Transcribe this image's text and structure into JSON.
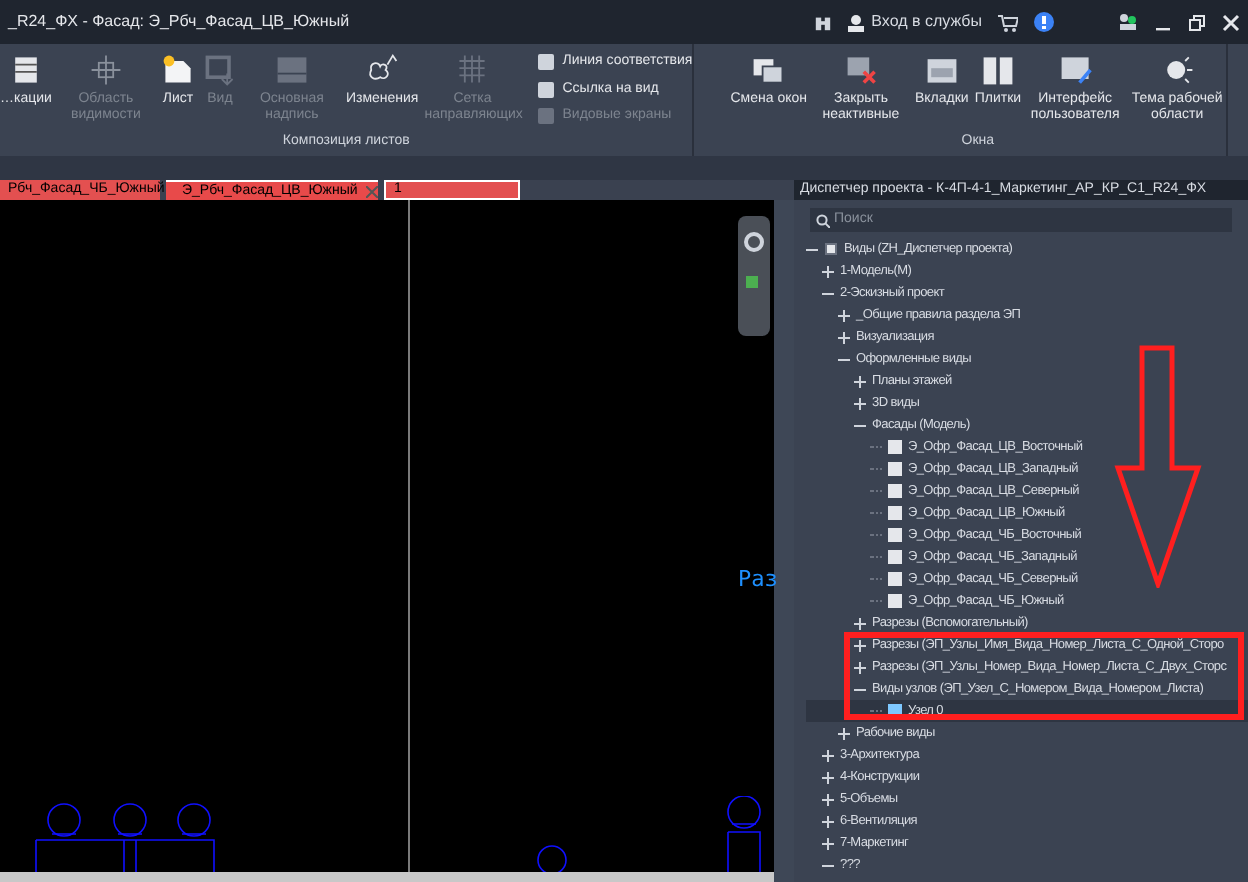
{
  "window": {
    "title": "_R24_ФХ - Фасад: Э_Рбч_Фасад_ЦВ_Южный",
    "sign_in": "Вход в службы"
  },
  "ribbon": {
    "panels": [
      {
        "label": "Композиция листов",
        "buttons": [
          {
            "label": "…кации",
            "disabled": false
          },
          {
            "label": "Область видимости",
            "disabled": true
          },
          {
            "label": "Лист",
            "disabled": false
          },
          {
            "label": "Вид",
            "disabled": true
          },
          {
            "label": "Основная надпись",
            "disabled": true
          },
          {
            "label": "Изменения",
            "disabled": false
          },
          {
            "label": "Сетка направляющих",
            "disabled": true
          }
        ],
        "small_buttons": [
          {
            "label": "Линия соответствия",
            "disabled": false
          },
          {
            "label": "Ссылка на вид",
            "disabled": false
          },
          {
            "label": "Видовые экраны",
            "disabled": true
          }
        ]
      },
      {
        "label": "Окна",
        "buttons": [
          {
            "label": "Смена окон",
            "disabled": false
          },
          {
            "label": "Закрыть неактивные",
            "disabled": false
          },
          {
            "label": "Вкладки",
            "disabled": false
          },
          {
            "label": "Плитки",
            "disabled": false
          },
          {
            "label": "Интерфейс пользователя",
            "disabled": false
          },
          {
            "label": "Тема рабочей области",
            "disabled": false
          }
        ]
      }
    ]
  },
  "tabs": [
    {
      "label": "Рбч_Фасад_ЧБ_Южный",
      "selected": false
    },
    {
      "label": "Э_Рбч_Фасад_ЦВ_Южный",
      "selected": true
    },
    {
      "label": "1",
      "selected": false
    }
  ],
  "canvas": {
    "label": "Раз"
  },
  "project_browser": {
    "title": "Диспетчер проекта - К-4П-4-1_Маркетинг_АР_КР_С1_R24_ФХ",
    "search": {
      "placeholder": "Поиск"
    },
    "tree": [
      {
        "label": "Виды (ZH_Диспетчер проекта)",
        "kind": "root",
        "expanded": true,
        "selected": false,
        "children": [
          {
            "label": "1-Модель(М)",
            "kind": "folder",
            "expanded": false,
            "selected": false
          },
          {
            "label": "2-Эскизный проект",
            "kind": "folder",
            "expanded": true,
            "selected": false,
            "children": [
              {
                "label": "_Общие правила раздела ЭП",
                "kind": "folder",
                "expanded": false,
                "selected": false
              },
              {
                "label": "Визуализация",
                "kind": "folder",
                "expanded": false,
                "selected": false
              },
              {
                "label": "Оформленные виды",
                "kind": "folder",
                "expanded": true,
                "selected": false,
                "children": [
                  {
                    "label": "Планы этажей",
                    "kind": "folder",
                    "expanded": false,
                    "selected": false
                  },
                  {
                    "label": "3D виды",
                    "kind": "folder",
                    "expanded": false,
                    "selected": false
                  },
                  {
                    "label": "Фасады (Модель)",
                    "kind": "folder",
                    "expanded": true,
                    "selected": false,
                    "children": [
                      {
                        "label": "Э_Офр_Фасад_ЦВ_Восточный",
                        "kind": "view",
                        "selected": false
                      },
                      {
                        "label": "Э_Офр_Фасад_ЦВ_Западный",
                        "kind": "view",
                        "selected": false
                      },
                      {
                        "label": "Э_Офр_Фасад_ЦВ_Северный",
                        "kind": "view",
                        "selected": false
                      },
                      {
                        "label": "Э_Офр_Фасад_ЦВ_Южный",
                        "kind": "view",
                        "selected": false
                      },
                      {
                        "label": "Э_Офр_Фасад_ЧБ_Восточный",
                        "kind": "view",
                        "selected": false
                      },
                      {
                        "label": "Э_Офр_Фасад_ЧБ_Западный",
                        "kind": "view",
                        "selected": false
                      },
                      {
                        "label": "Э_Офр_Фасад_ЧБ_Северный",
                        "kind": "view",
                        "selected": false
                      },
                      {
                        "label": "Э_Офр_Фасад_ЧБ_Южный",
                        "kind": "view",
                        "selected": false
                      }
                    ]
                  },
                  {
                    "label": "Разрезы (Вспомогательный)",
                    "kind": "folder",
                    "expanded": false,
                    "selected": false
                  },
                  {
                    "label": "Разрезы (ЭП_Узлы_Имя_Вида_Номер_Листа_С_Одной_Сторо",
                    "kind": "folder",
                    "expanded": false,
                    "selected": false
                  },
                  {
                    "label": "Разрезы (ЭП_Узлы_Номер_Вида_Номер_Листа_С_Двух_Сторс",
                    "kind": "folder",
                    "expanded": false,
                    "selected": false
                  },
                  {
                    "label": "Виды узлов (ЭП_Узел_С_Номером_Вида_Номером_Листа)",
                    "kind": "folder",
                    "expanded": true,
                    "selected": false,
                    "children": [
                      {
                        "label": "Узел 0",
                        "kind": "view",
                        "selected": true
                      }
                    ]
                  }
                ]
              },
              {
                "label": "Рабочие виды",
                "kind": "folder",
                "expanded": false,
                "selected": false
              }
            ]
          },
          {
            "label": "3-Архитектура",
            "kind": "folder",
            "expanded": false,
            "selected": false
          },
          {
            "label": "4-Конструкции",
            "kind": "folder",
            "expanded": false,
            "selected": false
          },
          {
            "label": "5-Объемы",
            "kind": "folder",
            "expanded": false,
            "selected": false
          },
          {
            "label": "6-Вентиляция",
            "kind": "folder",
            "expanded": false,
            "selected": false
          },
          {
            "label": "7-Маркетинг",
            "kind": "folder",
            "expanded": false,
            "selected": false
          },
          {
            "label": "???",
            "kind": "folder",
            "expanded": true,
            "selected": false
          }
        ]
      }
    ]
  }
}
